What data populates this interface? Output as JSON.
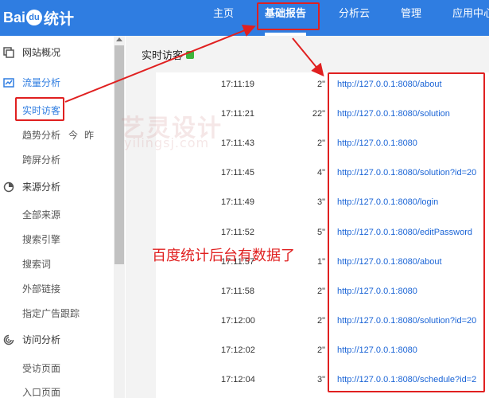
{
  "header": {
    "logo": {
      "part1": "Bai",
      "part2": "du",
      "part3": "统计"
    },
    "nav": [
      {
        "label": "主页",
        "active": false
      },
      {
        "label": "基础报告",
        "active": true
      },
      {
        "label": "分析云",
        "active": false
      },
      {
        "label": "管理",
        "active": false
      },
      {
        "label": "应用中心",
        "active": false
      }
    ]
  },
  "sidebar": {
    "groups": [
      {
        "label": "网站概况",
        "icon": "site-overview-icon"
      },
      {
        "label": "流量分析",
        "icon": "traffic-chart-icon",
        "children": [
          {
            "label": "实时访客",
            "active": true
          },
          {
            "label": "趋势分析",
            "extra": [
              "今",
              "昨"
            ]
          },
          {
            "label": "跨屏分析"
          }
        ]
      },
      {
        "label": "来源分析",
        "icon": "source-pie-icon",
        "children": [
          {
            "label": "全部来源"
          },
          {
            "label": "搜索引擎"
          },
          {
            "label": "搜索词"
          },
          {
            "label": "外部链接"
          },
          {
            "label": "指定广告跟踪"
          }
        ]
      },
      {
        "label": "访问分析",
        "icon": "visit-analysis-icon",
        "children": [
          {
            "label": "受访页面"
          },
          {
            "label": "入口页面"
          }
        ]
      }
    ]
  },
  "main": {
    "title": "实时访客",
    "rows": [
      {
        "time": "17:11:19",
        "duration": "2\"",
        "url": "http://127.0.0.1:8080/about"
      },
      {
        "time": "17:11:21",
        "duration": "22\"",
        "url": "http://127.0.0.1:8080/solution"
      },
      {
        "time": "17:11:43",
        "duration": "2\"",
        "url": "http://127.0.0.1:8080"
      },
      {
        "time": "17:11:45",
        "duration": "4\"",
        "url": "http://127.0.0.1:8080/solution?id=20"
      },
      {
        "time": "17:11:49",
        "duration": "3\"",
        "url": "http://127.0.0.1:8080/login"
      },
      {
        "time": "17:11:52",
        "duration": "5\"",
        "url": "http://127.0.0.1:8080/editPassword"
      },
      {
        "time": "17:11:57",
        "duration": "1\"",
        "url": "http://127.0.0.1:8080/about"
      },
      {
        "time": "17:11:58",
        "duration": "2\"",
        "url": "http://127.0.0.1:8080"
      },
      {
        "time": "17:12:00",
        "duration": "2\"",
        "url": "http://127.0.0.1:8080/solution?id=20"
      },
      {
        "time": "17:12:02",
        "duration": "2\"",
        "url": "http://127.0.0.1:8080"
      },
      {
        "time": "17:12:04",
        "duration": "3\"",
        "url": "http://127.0.0.1:8080/schedule?id=2"
      }
    ]
  },
  "annotation": "百度统计后台有数据了",
  "watermark": {
    "main": "艺灵设计",
    "sub": "yilingsj.com"
  },
  "colors": {
    "brand": "#2f7de1",
    "highlight": "#e02020",
    "link": "#1a64d6"
  }
}
